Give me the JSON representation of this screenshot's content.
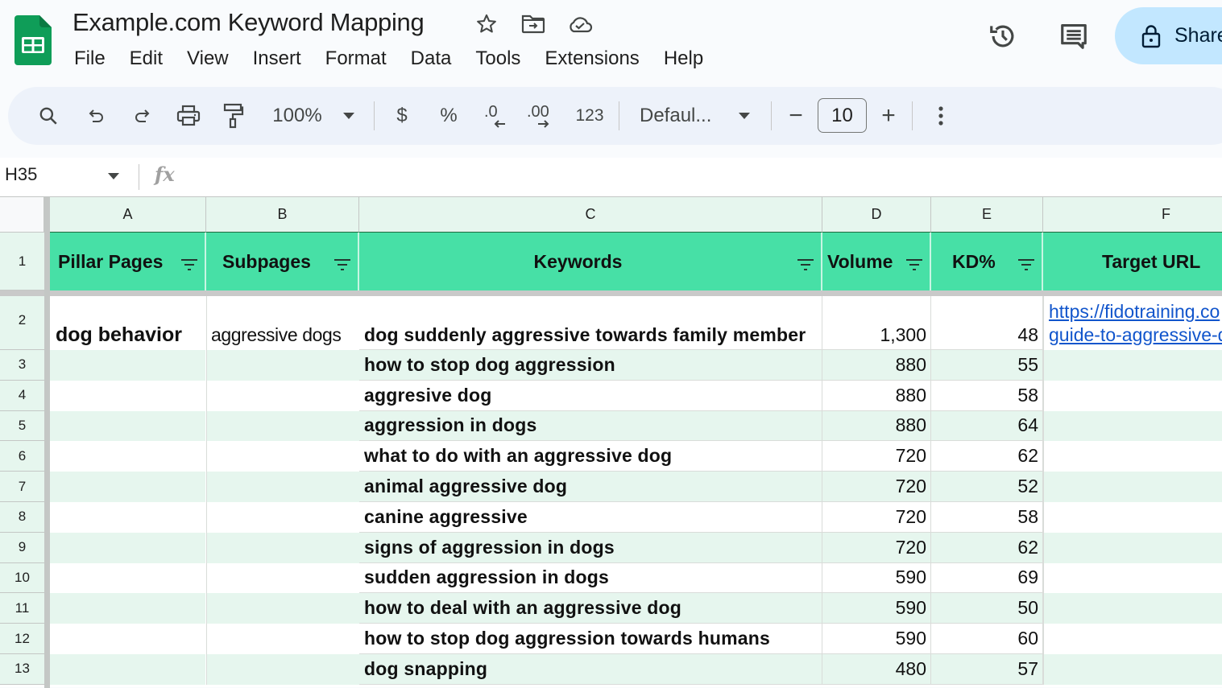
{
  "app": {
    "doc_title": "Example.com Keyword Mapping",
    "menu": [
      "File",
      "Edit",
      "View",
      "Insert",
      "Format",
      "Data",
      "Tools",
      "Extensions",
      "Help"
    ],
    "share_label": "Share"
  },
  "toolbar": {
    "zoom": "100%",
    "currency": "$",
    "percent": "%",
    "decrease_decimal": ".0",
    "increase_decimal": ".00",
    "number_format": "123",
    "font": "Defaul...",
    "font_size": "10",
    "minus": "−",
    "plus": "+"
  },
  "formula_bar": {
    "name_box": "H35",
    "fx": "fx",
    "formula": ""
  },
  "sheet": {
    "column_letters": [
      "A",
      "B",
      "C",
      "D",
      "E",
      "F"
    ],
    "header_row_number": "1",
    "headers": [
      "Pillar Pages",
      "Subpages",
      "Keywords",
      "Volume",
      "KD%",
      "Target URL"
    ],
    "pillar_page": "dog behavior",
    "subpage": "aggressive dogs",
    "target_url_line1": "https://fidotraining.co",
    "target_url_line2": "guide-to-aggressive-d",
    "rows": [
      {
        "num": "2",
        "keyword": "dog suddenly aggressive towards family member",
        "volume": "1,300",
        "kd": "48"
      },
      {
        "num": "3",
        "keyword": "how to stop dog aggression",
        "volume": "880",
        "kd": "55"
      },
      {
        "num": "4",
        "keyword": "aggresive dog",
        "volume": "880",
        "kd": "58"
      },
      {
        "num": "5",
        "keyword": "aggression in dogs",
        "volume": "880",
        "kd": "64"
      },
      {
        "num": "6",
        "keyword": "what to do with an aggressive dog",
        "volume": "720",
        "kd": "62"
      },
      {
        "num": "7",
        "keyword": "animal aggressive dog",
        "volume": "720",
        "kd": "52"
      },
      {
        "num": "8",
        "keyword": "canine aggressive",
        "volume": "720",
        "kd": "58"
      },
      {
        "num": "9",
        "keyword": "signs of aggression in dogs",
        "volume": "720",
        "kd": "62"
      },
      {
        "num": "10",
        "keyword": "sudden aggression in dogs",
        "volume": "590",
        "kd": "69"
      },
      {
        "num": "11",
        "keyword": "how to deal with an aggressive dog",
        "volume": "590",
        "kd": "50"
      },
      {
        "num": "12",
        "keyword": "how to stop dog aggression towards humans",
        "volume": "590",
        "kd": "60"
      },
      {
        "num": "13",
        "keyword": "dog snapping",
        "volume": "480",
        "kd": "57"
      }
    ]
  },
  "colors": {
    "header_fill": "#47e0a6",
    "band_fill": "#e6f6ee",
    "share_fill": "#c2e7ff",
    "link": "#1155cc",
    "logo_green": "#0f9d58"
  }
}
